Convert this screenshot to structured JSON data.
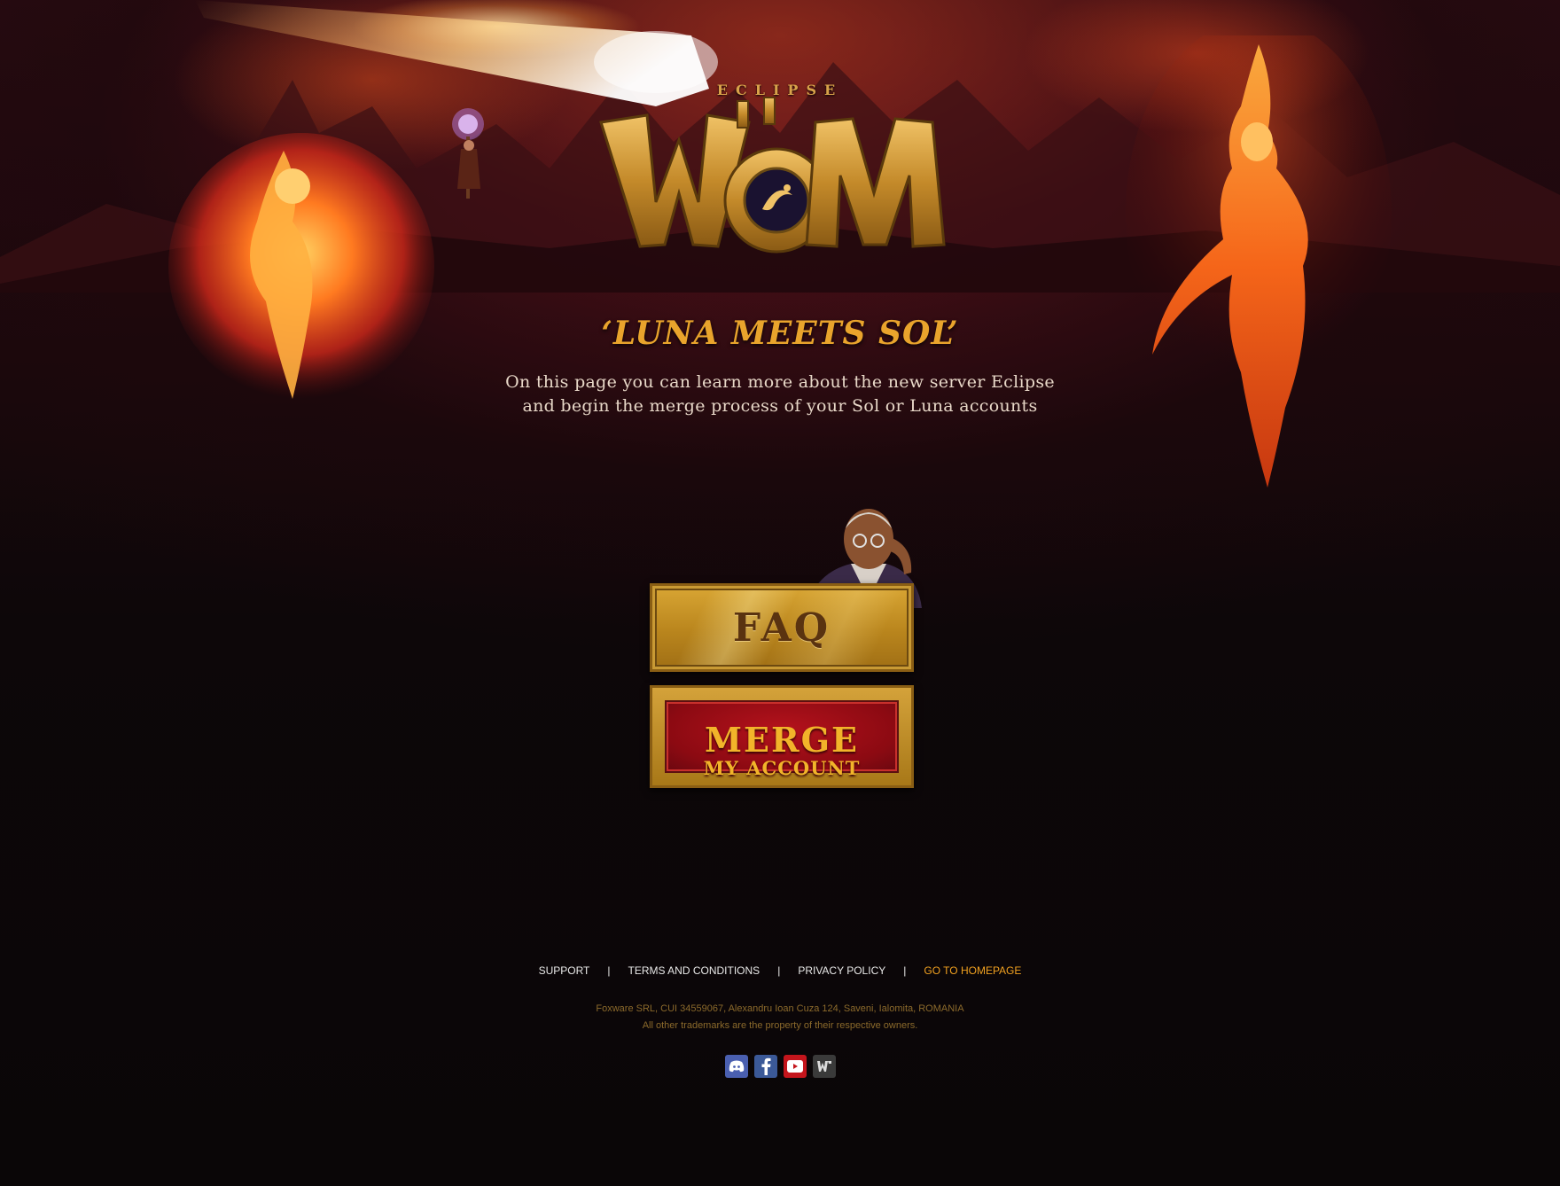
{
  "logo": {
    "eclipse_label": "ECLIPSE",
    "wordmark": "WoM"
  },
  "hero": {
    "headline": "‘LUNA MEETS SOL’",
    "intro_line1": "On this page you can learn more about the new server Eclipse",
    "intro_line2": "and begin the merge process of your Sol or Luna accounts"
  },
  "buttons": {
    "faq_label": "FAQ",
    "merge_line1": "MERGE",
    "merge_line2": "MY ACCOUNT"
  },
  "footer": {
    "links": [
      {
        "label": "SUPPORT"
      },
      {
        "label": "TERMS AND CONDITIONS"
      },
      {
        "label": "PRIVACY POLICY"
      },
      {
        "label": "GO TO HOMEPAGE"
      }
    ],
    "separator": "|",
    "legal_line1": "Foxware SRL, CUI 34559067, Alexandru Ioan Cuza 124, Saveni, Ialomita, ROMANIA",
    "legal_line2": "All other trademarks are the property of their respective owners."
  },
  "social": [
    {
      "icon": "discord-icon",
      "color": "#4a5fb0"
    },
    {
      "icon": "facebook-icon",
      "color": "#3b5998"
    },
    {
      "icon": "youtube-icon",
      "color": "#c4151c"
    },
    {
      "icon": "wom-icon",
      "color": "#3a3a3a"
    }
  ],
  "colors": {
    "accent_gold": "#e9a42c",
    "link_accent": "#f0a020",
    "legal_text": "#8c6a2c",
    "merge_red": "#9e0d16"
  }
}
